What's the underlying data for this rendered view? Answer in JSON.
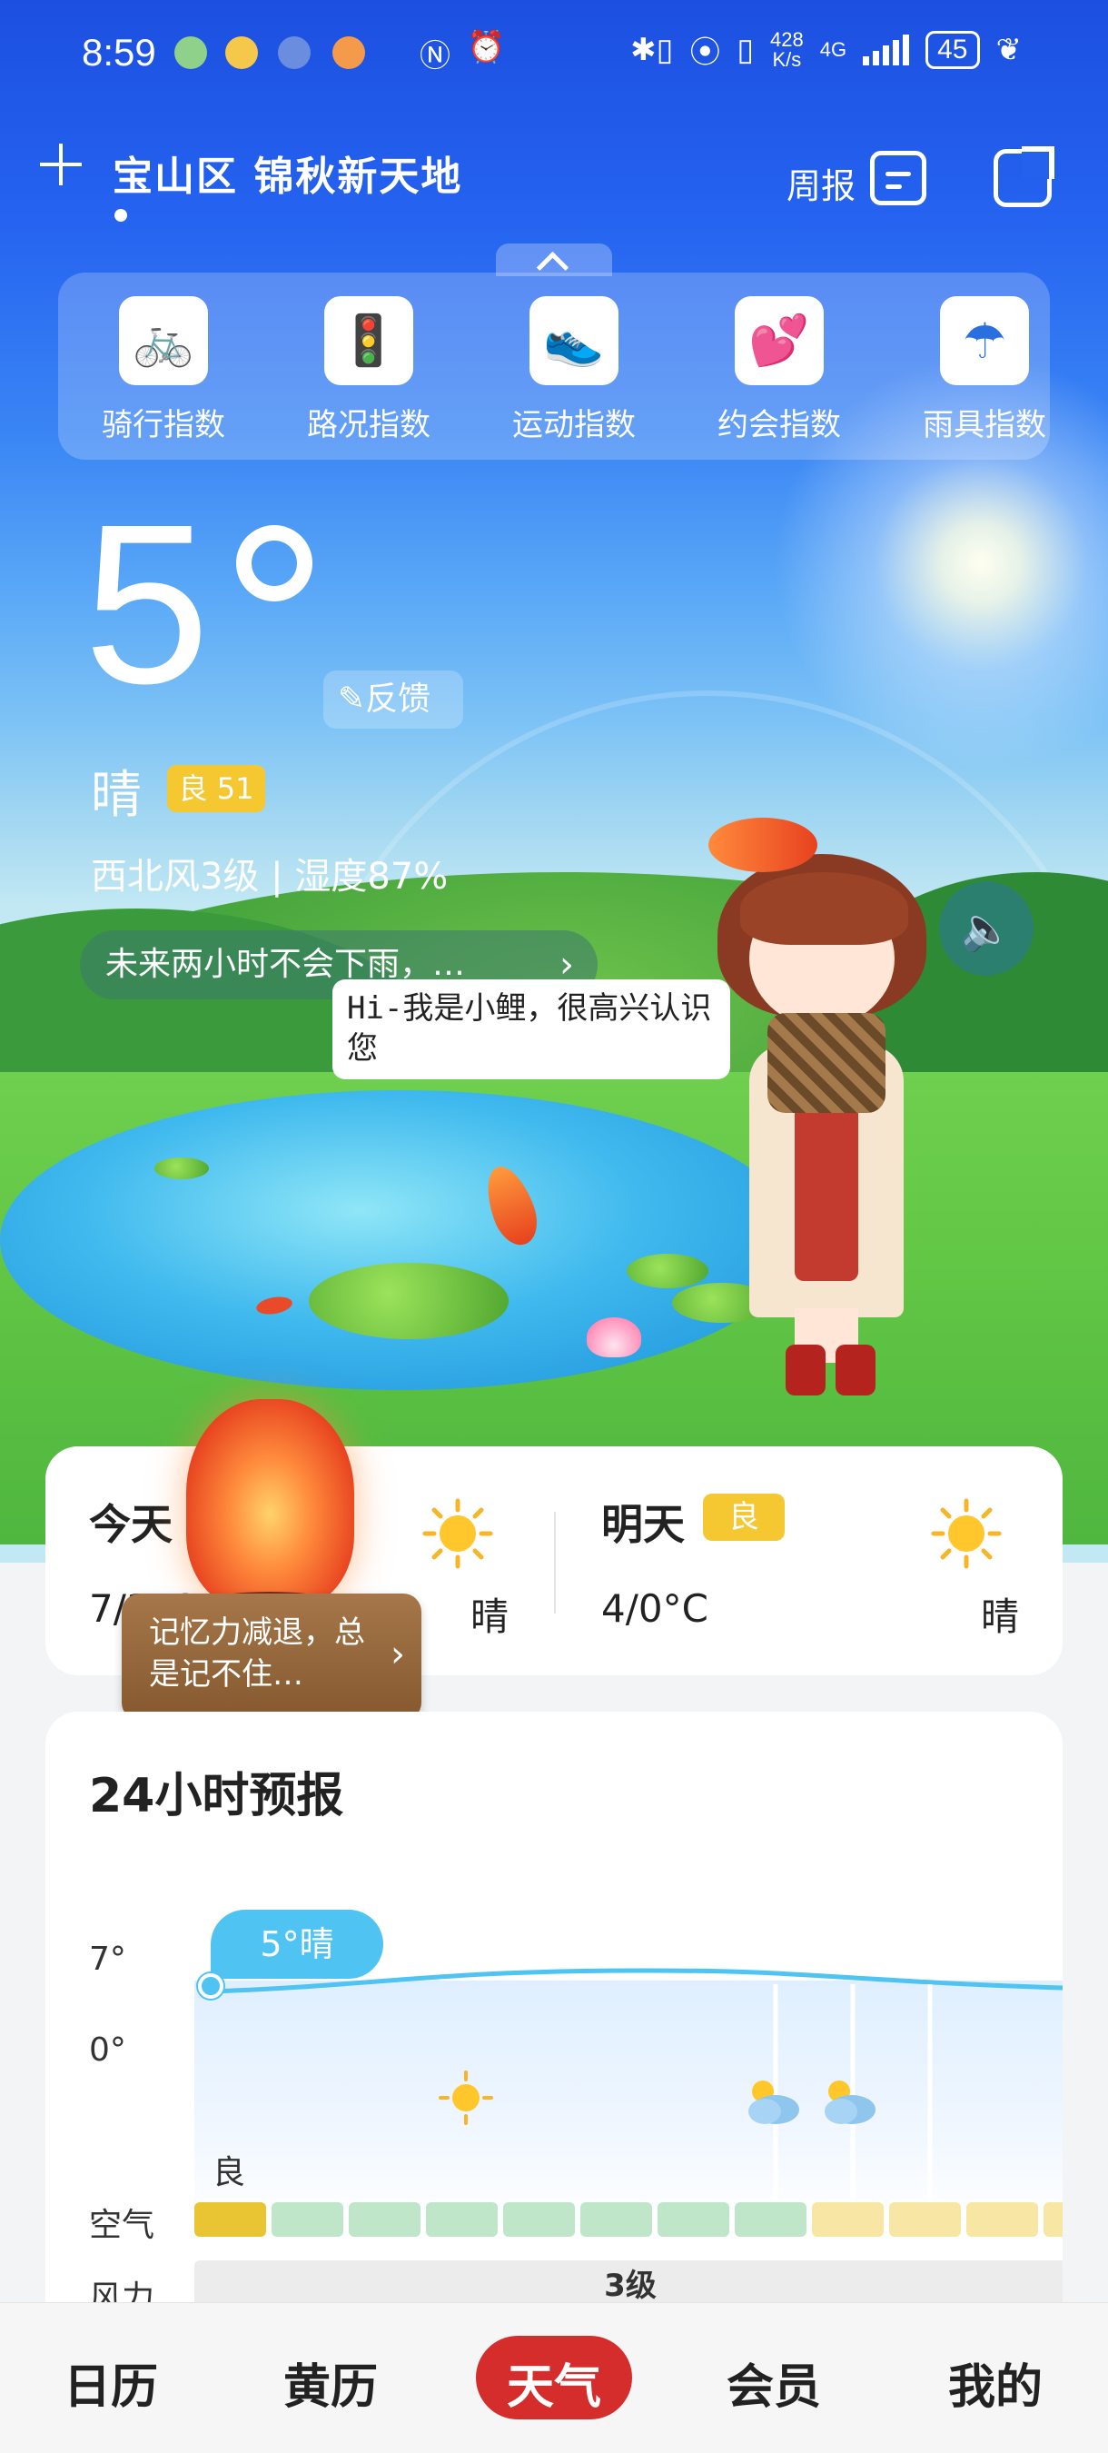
{
  "status_bar": {
    "time": "8:59",
    "net_speed_top": "428",
    "net_speed_unit": "K/s",
    "network": "4G",
    "battery": "45"
  },
  "header": {
    "add_icon": "plus-icon",
    "location": "宝山区  锦秋新天地",
    "weekly_label": "周报",
    "calendar_icon": "calendar-icon",
    "share_icon": "share-icon"
  },
  "indices": [
    {
      "label": "骑行指数",
      "icon": "bike-icon",
      "glyph": "🚲"
    },
    {
      "label": "路况指数",
      "icon": "traffic-light-icon",
      "glyph": "🚦"
    },
    {
      "label": "运动指数",
      "icon": "shoe-icon",
      "glyph": "👟"
    },
    {
      "label": "约会指数",
      "icon": "hearts-icon",
      "glyph": "💕"
    },
    {
      "label": "雨具指数",
      "icon": "umbrella-icon",
      "glyph": "☂"
    }
  ],
  "current": {
    "temperature": "5",
    "feedback_label": "反馈",
    "condition": "晴",
    "aqi_badge": "良 51",
    "wind_humidity": "西北风3级 | 湿度87%",
    "rain_forecast": "未来两小时不会下雨，…",
    "assistant_greeting": "Hi-我是小鲤，很高兴认识您"
  },
  "days": {
    "today": {
      "title": "今天",
      "temps": "7/3°C",
      "condition": "晴"
    },
    "tomorrow": {
      "title": "明天",
      "badge": "良",
      "temps": "4/0°C",
      "condition": "晴"
    }
  },
  "memory_prompt": "记忆力减退，总是记不住…",
  "forecast24": {
    "title": "24小时预报",
    "axis_high": "7°",
    "axis_low": "0°",
    "bubble": "5°晴",
    "aqi_label": "良",
    "air_label": "空气",
    "wind_label": "风力",
    "wind_level": "3级",
    "air_colors": [
      "#e9c534",
      "#bfe6c9",
      "#bfe6c9",
      "#bfe6c9",
      "#bfe6c9",
      "#bfe6c9",
      "#bfe6c9",
      "#bfe6c9",
      "#f7e6a4",
      "#f7e6a4",
      "#f7e6a4",
      "#f7e6a4"
    ]
  },
  "nav": [
    "日历",
    "黄历",
    "天气",
    "会员",
    "我的"
  ],
  "colors": {
    "accent": "#d52c2c",
    "aqi_good": "#f5c831",
    "forecast_line": "#4fc3f2"
  }
}
